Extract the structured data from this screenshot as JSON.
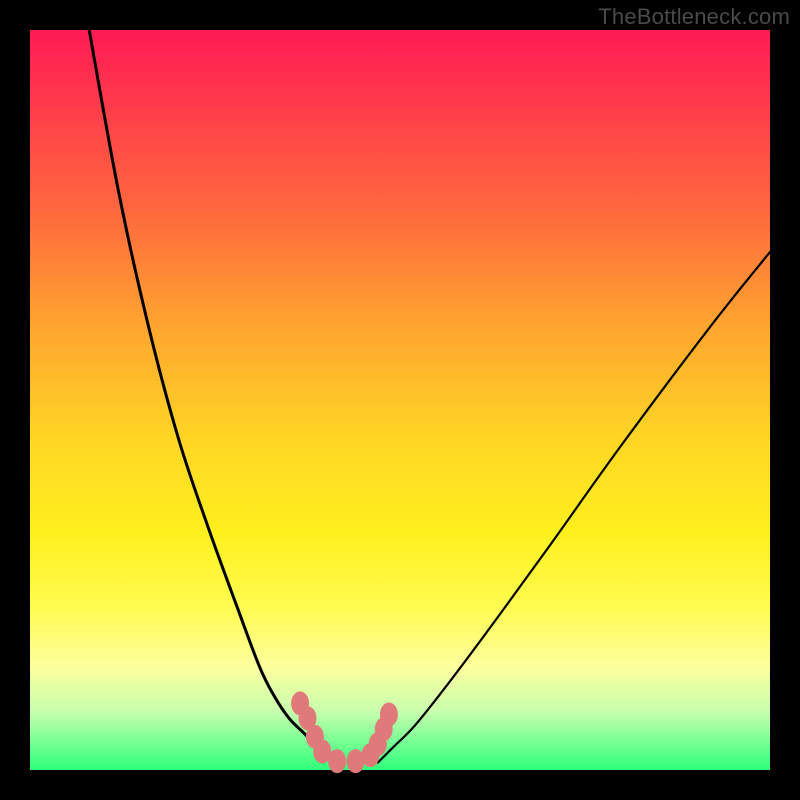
{
  "watermark": "TheBottleneck.com",
  "chart_data": {
    "type": "line",
    "title": "",
    "xlabel": "",
    "ylabel": "",
    "xlim": [
      0,
      100
    ],
    "ylim": [
      0,
      100
    ],
    "series": [
      {
        "name": "left-curve",
        "x": [
          8,
          12,
          16,
          20,
          24,
          28,
          31,
          33,
          35,
          37,
          38.5,
          40,
          41
        ],
        "y": [
          100,
          78,
          60,
          45,
          33,
          22,
          14,
          10,
          7,
          5,
          3.5,
          2,
          1
        ]
      },
      {
        "name": "right-curve",
        "x": [
          47,
          49,
          52,
          56,
          62,
          70,
          80,
          92,
          100
        ],
        "y": [
          1,
          3,
          6,
          11,
          19,
          30,
          44,
          60,
          70
        ]
      },
      {
        "name": "valley-markers",
        "x": [
          36.5,
          37.5,
          38.5,
          39.5,
          41.5,
          44.0,
          46.0,
          47.0,
          47.8,
          48.5
        ],
        "y": [
          9.0,
          7.0,
          4.5,
          2.5,
          1.2,
          1.2,
          2.0,
          3.5,
          5.5,
          7.5
        ]
      }
    ],
    "marker_color": "#e07a7a",
    "curve_color": "#000000"
  }
}
